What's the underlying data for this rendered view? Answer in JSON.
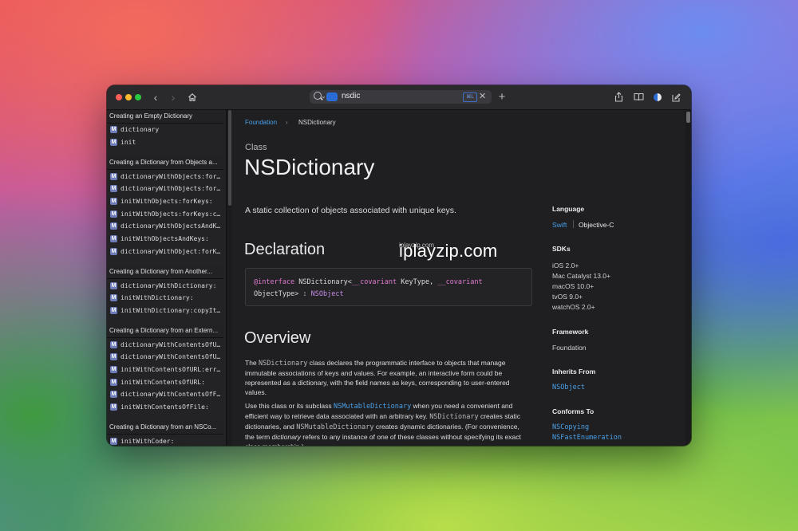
{
  "toolbar": {
    "search_query": "nsdic",
    "scope_icon": "apple-icon",
    "kbd_badge": "⌘L",
    "clear_glyph": "✕",
    "back_glyph": "‹",
    "forward_glyph": "›",
    "plus_glyph": "+"
  },
  "sidebar": {
    "groups": [
      {
        "title": "Creating an Empty Dictionary",
        "items": [
          "dictionary",
          "init"
        ]
      },
      {
        "title": "Creating a Dictionary from Objects a...",
        "items": [
          "dictionaryWithObjects:for…",
          "dictionaryWithObjects:for…",
          "initWithObjects:forKeys:",
          "initWithObjects:forKeys:c…",
          "dictionaryWithObjectsAndK…",
          "initWithObjectsAndKeys:",
          "dictionaryWithObject:forK…"
        ]
      },
      {
        "title": "Creating a Dictionary from Another...",
        "items": [
          "dictionaryWithDictionary:",
          "initWithDictionary:",
          "initWithDictionary:copyIt…"
        ]
      },
      {
        "title": "Creating a Dictionary from an Extern...",
        "items": [
          "dictionaryWithContentsOfU…",
          "dictionaryWithContentsOfU…",
          "initWithContentsOfURL:err…",
          "initWithContentsOfURL:",
          "dictionaryWithContentsOfF…",
          "initWithContentsOfFile:"
        ]
      },
      {
        "title": "Creating a Dictionary from an NSCo...",
        "items": [
          "initWithCoder:"
        ]
      }
    ],
    "badge": "M"
  },
  "content": {
    "breadcrumb": {
      "parent": "Foundation",
      "separator": "›",
      "current": "NSDictionary"
    },
    "kind": "Class",
    "title": "NSDictionary",
    "abstract": "A static collection of objects associated with unique keys.",
    "declaration_heading": "Declaration",
    "declaration": {
      "kw_interface": "@interface",
      "name": " NSDictionary<",
      "kw_cov1": "__covariant",
      "mid1": " KeyType, ",
      "kw_cov2": "__covariant",
      "line2_a": "ObjectType> : ",
      "super": "NSObject"
    },
    "overview_heading": "Overview",
    "p1": {
      "a": "The ",
      "code1": "NSDictionary",
      "b": " class declares the programmatic interface to objects that manage immutable associations of keys and values. For example, an interactive form could be represented as a dictionary, with the field names as keys, corresponding to user-entered values."
    },
    "p2": {
      "a": "Use this class or its subclass ",
      "link1": "NSMutableDictionary",
      "b": " when you need a convenient and efficient way to retrieve data associated with an arbitrary key. ",
      "code1": "NSDictionary",
      "c": " creates static dictionaries, and ",
      "code2": "NSMutableDictionary",
      "d": " creates dynamic dictionaries. (For convenience, the term ",
      "em": "dictionary",
      "e": " refers to any instance of one of these classes without specifying its exact class membership.)"
    }
  },
  "aside": {
    "language_heading": "Language",
    "lang_swift": "Swift",
    "lang_objc": "Objective-C",
    "sdks_heading": "SDKs",
    "sdks": [
      "iOS 2.0+",
      "Mac Catalyst 13.0+",
      "macOS 10.0+",
      "tvOS 9.0+",
      "watchOS 2.0+"
    ],
    "framework_heading": "Framework",
    "framework": "Foundation",
    "inherits_heading": "Inherits From",
    "inherits": "NSObject",
    "conforms_heading": "Conforms To",
    "conforms": [
      "NSCopying",
      "NSFastEnumeration"
    ]
  },
  "watermark": {
    "large": "iplayzip.com",
    "small": "iplayzip.com"
  },
  "colors": {
    "link": "#4aa0e8",
    "keyword": "#e07ad0",
    "badge": "#6d7bb8"
  }
}
